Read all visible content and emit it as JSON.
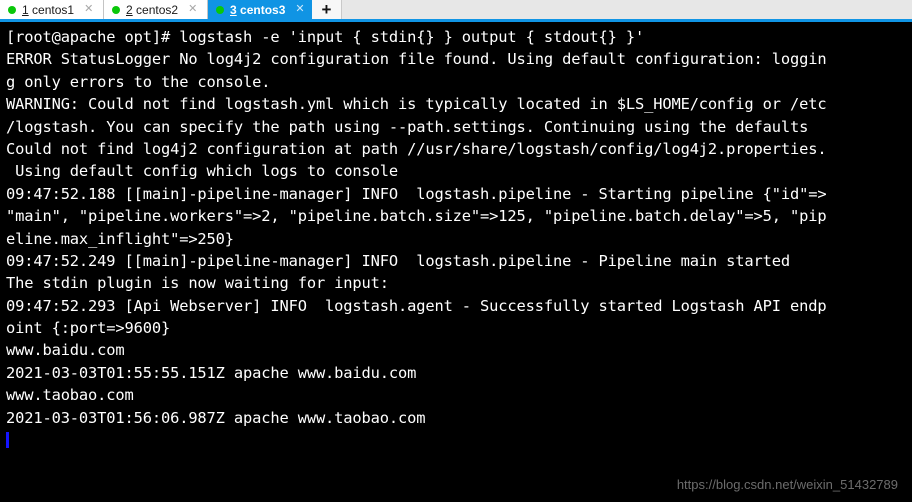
{
  "window": {
    "title": "3 centos3",
    "accent_color": "#1094e4",
    "tabbar_bg": "#e7e7e7",
    "terminal_bg": "#000000",
    "terminal_fg": "#ffffff",
    "cursor_color": "#1414ff",
    "status_dot_color": "#0ac70a"
  },
  "tabbar": {
    "tabs": [
      {
        "number": "1",
        "name": " centos1",
        "active": false,
        "close_glyph": "✕",
        "dot": "connected"
      },
      {
        "number": "2",
        "name": " centos2",
        "active": false,
        "close_glyph": "✕",
        "dot": "connected"
      },
      {
        "number": "3",
        "name": " centos3",
        "active": true,
        "close_glyph": "✕",
        "dot": "connected"
      }
    ],
    "add_tab_label": "+"
  },
  "terminal": {
    "prompt": "[root@apache opt]# ",
    "command": "logstash -e 'input { stdin{} } output { stdout{} }'",
    "lines": [
      "[root@apache opt]# logstash -e 'input { stdin{} } output { stdout{} }'",
      "ERROR StatusLogger No log4j2 configuration file found. Using default configuration: loggin",
      "g only errors to the console.",
      "WARNING: Could not find logstash.yml which is typically located in $LS_HOME/config or /etc",
      "/logstash. You can specify the path using --path.settings. Continuing using the defaults",
      "Could not find log4j2 configuration at path //usr/share/logstash/config/log4j2.properties.",
      " Using default config which logs to console",
      "09:47:52.188 [[main]-pipeline-manager] INFO  logstash.pipeline - Starting pipeline {\"id\"=>",
      "\"main\", \"pipeline.workers\"=>2, \"pipeline.batch.size\"=>125, \"pipeline.batch.delay\"=>5, \"pip",
      "eline.max_inflight\"=>250}",
      "09:47:52.249 [[main]-pipeline-manager] INFO  logstash.pipeline - Pipeline main started",
      "The stdin plugin is now waiting for input:",
      "09:47:52.293 [Api Webserver] INFO  logstash.agent - Successfully started Logstash API endp",
      "oint {:port=>9600}",
      "www.baidu.com",
      "2021-03-03T01:55:55.151Z apache www.baidu.com",
      "www.taobao.com",
      "2021-03-03T01:56:06.987Z apache www.taobao.com"
    ],
    "cursor_line_index": 18
  },
  "watermark": {
    "text": "https://blog.csdn.net/weixin_51432789"
  }
}
